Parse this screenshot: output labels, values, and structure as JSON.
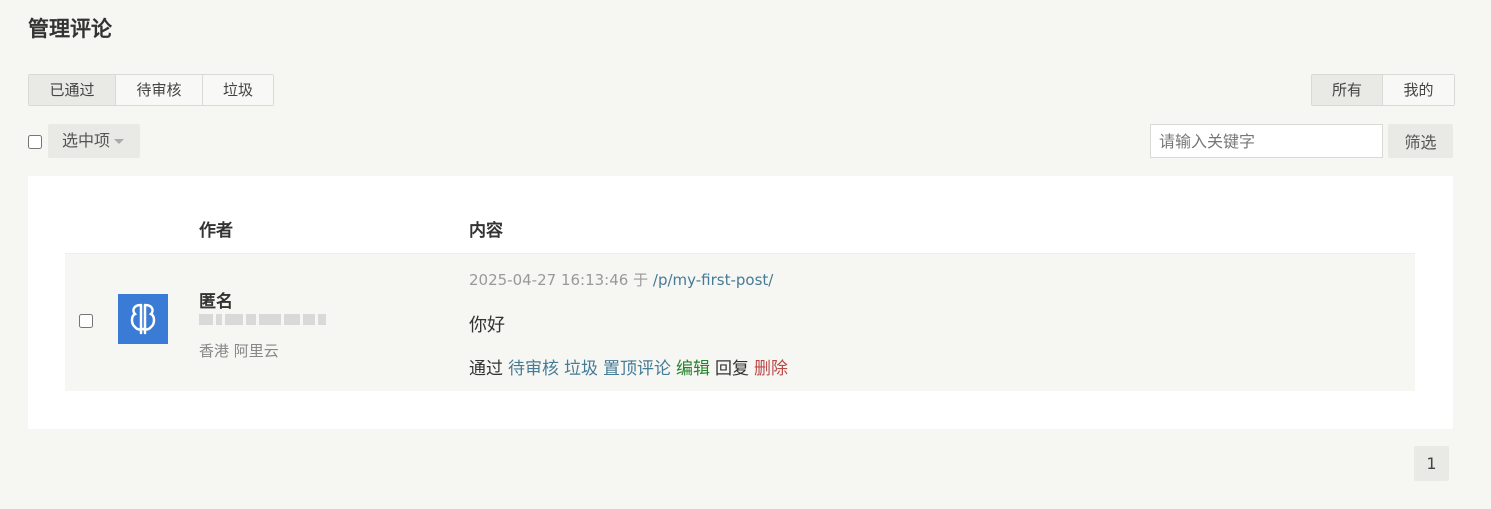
{
  "page": {
    "title": "管理评论"
  },
  "status_tabs": [
    {
      "label": "已通过",
      "active": true
    },
    {
      "label": "待审核",
      "active": false
    },
    {
      "label": "垃圾",
      "active": false
    }
  ],
  "scope_tabs": [
    {
      "label": "所有",
      "active": true
    },
    {
      "label": "我的",
      "active": false
    }
  ],
  "toolbar": {
    "bulk_label": "选中项",
    "search_placeholder": "请输入关键字",
    "filter_label": "筛选"
  },
  "table": {
    "headers": {
      "author": "作者",
      "content": "内容"
    },
    "rows": [
      {
        "author_name": "匿名",
        "author_location": "香港 阿里云",
        "date": "2025-04-27 16:13:46",
        "sep": "于",
        "post_path": "/p/my-first-post/",
        "text": "你好",
        "actions": {
          "approve": "通过",
          "pending": "待审核",
          "spam": "垃圾",
          "pin": "置顶评论",
          "edit": "编辑",
          "reply": "回复",
          "delete": "删除"
        }
      }
    ]
  },
  "pagination": {
    "current": "1"
  },
  "colors": {
    "link": "#467b96",
    "edit": "#25842c",
    "delete": "#b94a48",
    "avatar": "#3a7bd5"
  }
}
